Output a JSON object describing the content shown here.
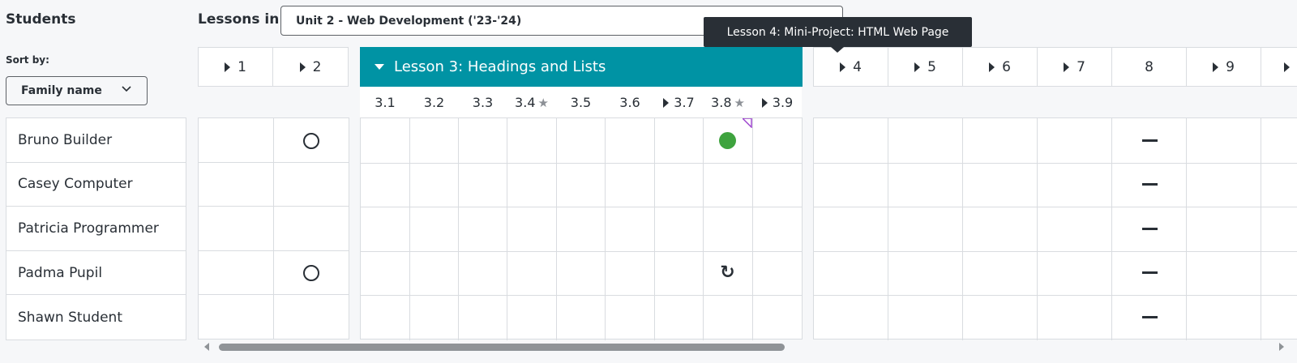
{
  "students_panel": {
    "title": "Students",
    "sort_label": "Sort by:",
    "sort_value": "Family name",
    "students": [
      "Bruno Builder",
      "Casey Computer",
      "Patricia Programmer",
      "Padma Pupil",
      "Shawn Student"
    ]
  },
  "lessons_header": {
    "label": "Lessons in",
    "unit_value": "Unit 2 - Web Development ('23-'24)"
  },
  "tooltip": "Lesson 4: Mini-Project: HTML Web Page",
  "lessons": {
    "l1": "1",
    "l2": "2",
    "l4": "4",
    "l5": "5",
    "l6": "6",
    "l7": "7",
    "l8": "8",
    "l9": "9"
  },
  "expanded_lesson": {
    "title": "Lesson 3: Headings and Lists",
    "levels": [
      "3.1",
      "3.2",
      "3.3",
      "3.4",
      "3.5",
      "3.6",
      "3.7",
      "3.8",
      "3.9"
    ]
  },
  "icons": {
    "star": "★",
    "retry": "↻"
  },
  "colors": {
    "accent": "#0093a4",
    "completed": "#3ea33e",
    "feedback": "#9b3fcc"
  }
}
